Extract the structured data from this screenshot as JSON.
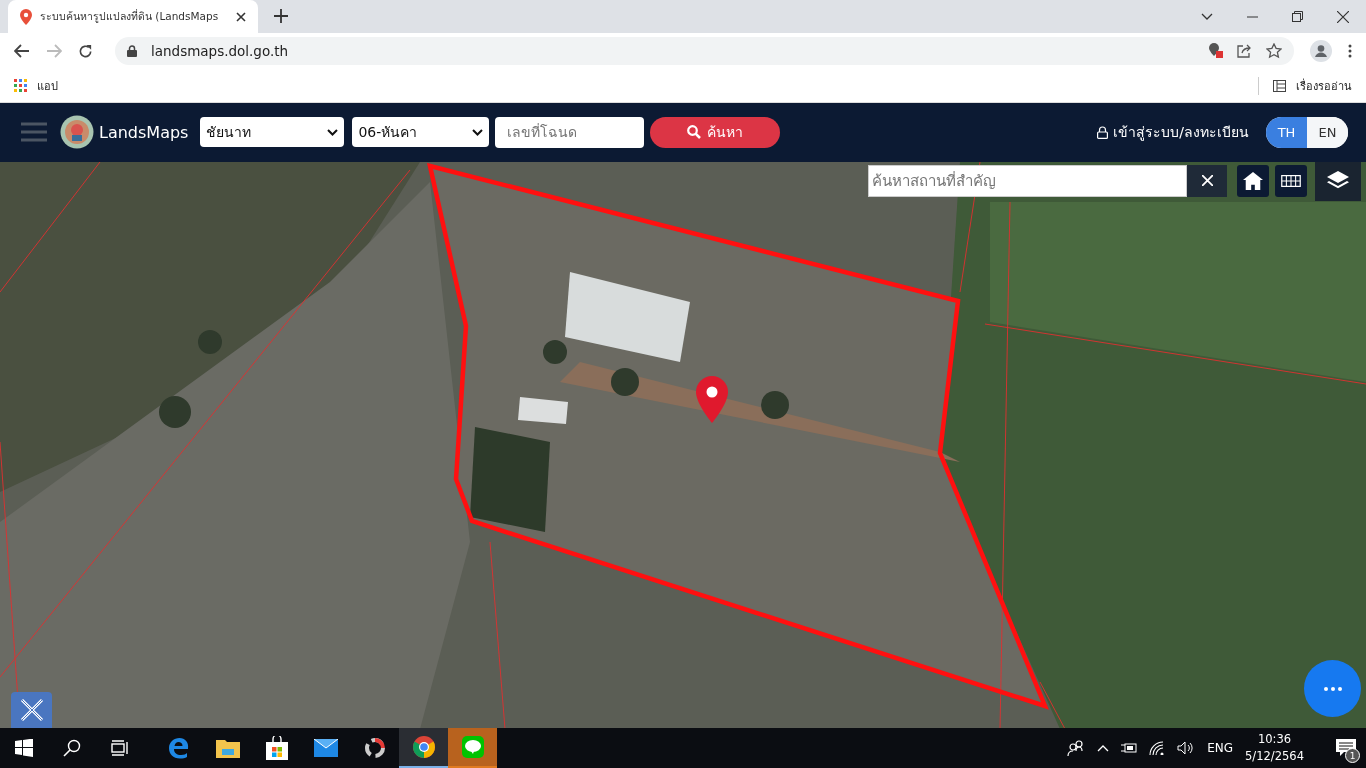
{
  "browser": {
    "tab_title": "ระบบค้นหารูปแปลงที่ดิน (LandsMaps",
    "url": "landsmaps.dol.go.th",
    "bookmarks": [
      {
        "label": "แอป"
      }
    ],
    "reading_list": "เรื่องรออ่าน"
  },
  "header": {
    "brand": "LandsMaps",
    "province": "ชัยนาท",
    "district": "06-หันคา",
    "deed_placeholder": "เลขที่โฉนด",
    "search_button": "ค้นหา",
    "login": "เข้าสู่ระบบ/ลงทะเบียน",
    "languages": [
      {
        "label": "TH",
        "selected": true
      },
      {
        "label": "EN",
        "selected": false
      }
    ]
  },
  "map": {
    "place_search_placeholder": "ค้นหาสถานที่สำคัญ"
  },
  "taskbar": {
    "apps": [
      {
        "kind": "edge",
        "open": false,
        "attention": false
      },
      {
        "kind": "explorer",
        "open": false,
        "attention": false
      },
      {
        "kind": "store",
        "open": false,
        "attention": false
      },
      {
        "kind": "mail",
        "open": false,
        "attention": false
      },
      {
        "kind": "capture",
        "open": false,
        "attention": false
      },
      {
        "kind": "chrome",
        "open": true,
        "attention": false
      },
      {
        "kind": "line",
        "open": true,
        "attention": true
      }
    ],
    "language": "ENG",
    "time": "10:36",
    "date": "5/12/2564",
    "notifications": "1"
  }
}
